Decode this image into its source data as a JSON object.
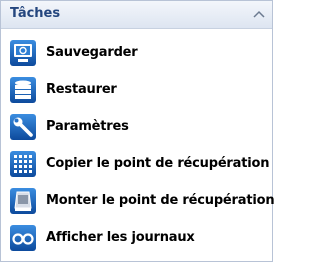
{
  "panel": {
    "title": "Tâches",
    "collapse_icon": "chevron-up-icon",
    "items": [
      {
        "label": "Sauvegarder",
        "icon": "backup-monitor-icon"
      },
      {
        "label": "Restaurer",
        "icon": "database-restore-icon"
      },
      {
        "label": "Paramètres",
        "icon": "wrench-icon"
      },
      {
        "label": "Copier le point de récupération",
        "icon": "grid-dots-icon"
      },
      {
        "label": "Monter le point de récupération",
        "icon": "drive-mount-icon"
      },
      {
        "label": "Afficher les journaux",
        "icon": "glasses-icon"
      }
    ]
  },
  "colors": {
    "header_text": "#24467e",
    "icon_blue": "#1a5fb4"
  }
}
